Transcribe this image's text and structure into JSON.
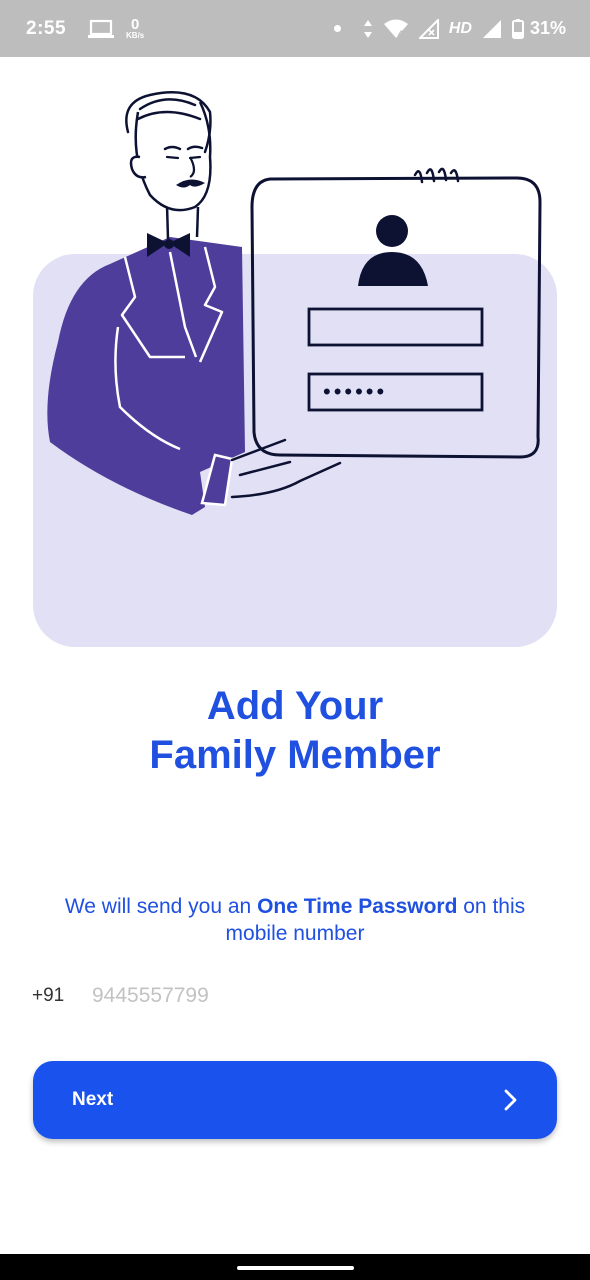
{
  "status_bar": {
    "time": "2:55",
    "speed_value": "0",
    "speed_unit": "KB/s",
    "network_type": "HD",
    "battery": "31%"
  },
  "illustration": {
    "password_mask": "••••••"
  },
  "title": {
    "line1": "Add Your",
    "line2": "Family Member"
  },
  "info": {
    "prefix": "We will send you an ",
    "bold": "One Time Password",
    "suffix": " on this mobile number"
  },
  "phone": {
    "country_code": "+91",
    "value": "",
    "placeholder": "9445557799"
  },
  "next_button": {
    "label": "Next"
  },
  "colors": {
    "accent": "#1a52ee",
    "title_blue": "#1f50e0",
    "illustration_bg": "#e1e0f4",
    "suit_purple": "#4f3d9b",
    "ink": "#0d1233",
    "status_bar_bg": "#bdbdbd"
  },
  "icons": [
    "laptop-icon",
    "data-arrows-icon",
    "wifi-icon",
    "signal-icon",
    "battery-icon",
    "user-avatar-icon",
    "chevron-right-icon"
  ]
}
